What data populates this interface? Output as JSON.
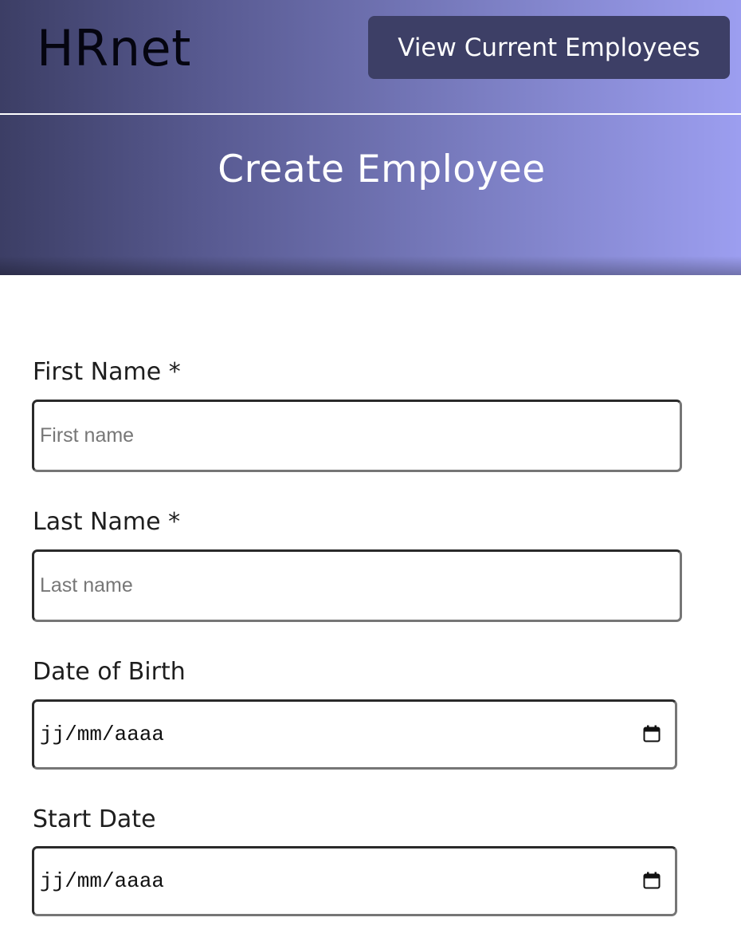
{
  "header": {
    "logo": "HRnet",
    "nav_button_label": "View Current Employees",
    "page_title": "Create Employee",
    "gradient_colors": [
      "#3c3e65",
      "#9c9ef0"
    ],
    "button_color": "#3d3f66"
  },
  "form": {
    "first_name": {
      "label": "First Name *",
      "placeholder": "First name",
      "value": ""
    },
    "last_name": {
      "label": "Last Name *",
      "placeholder": "Last name",
      "value": ""
    },
    "date_of_birth": {
      "label": "Date of Birth",
      "display": "jj/mm/aaaa",
      "icon": "calendar-icon"
    },
    "start_date": {
      "label": "Start Date",
      "display": "jj/mm/aaaa",
      "icon": "calendar-icon"
    }
  }
}
